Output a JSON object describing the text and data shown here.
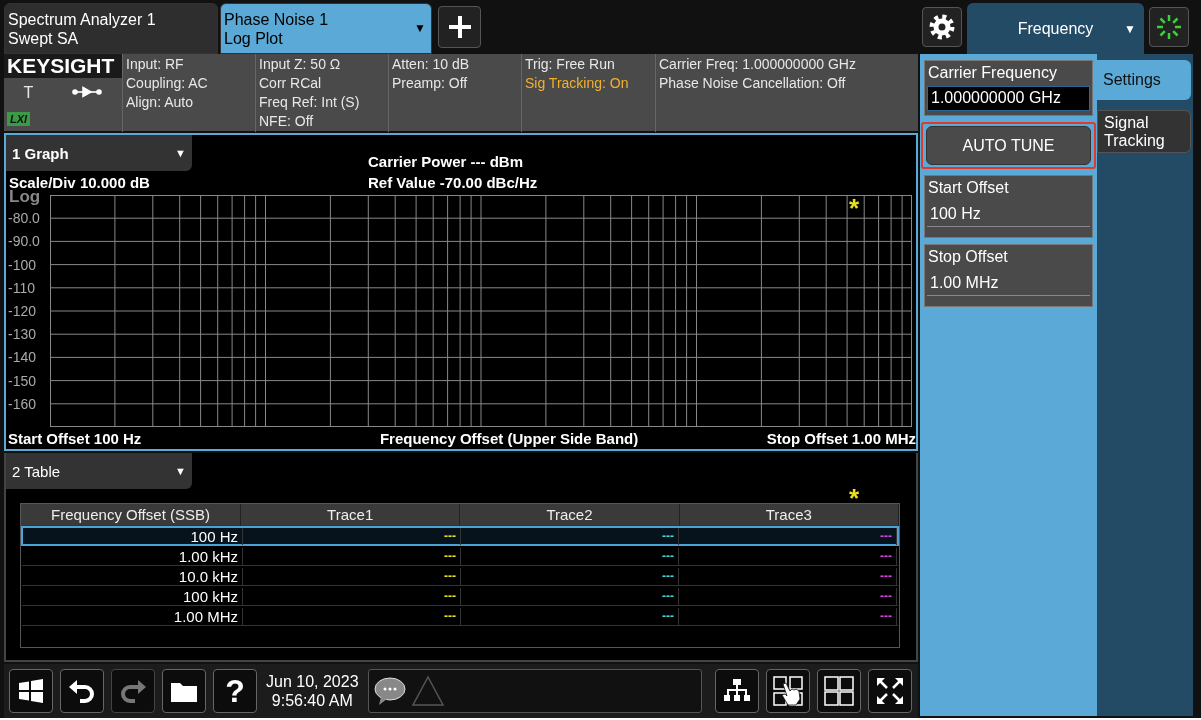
{
  "instrument_tabs": [
    {
      "line1": "Spectrum Analyzer 1",
      "line2": "Swept SA",
      "selected": false
    },
    {
      "line1": "Phase Noise 1",
      "line2": "Log Plot",
      "selected": true,
      "arrow": "▼"
    }
  ],
  "menu": {
    "label": "Frequency",
    "arrow": "▼"
  },
  "logo": {
    "brand": "KEYSIGHT",
    "trigger": "T",
    "lxi": "LXI"
  },
  "info_cells": [
    {
      "lines": [
        {
          "text": "Input: RF",
          "highlight": false
        },
        {
          "text": "Coupling: AC",
          "highlight": false
        },
        {
          "text": "Align: Auto",
          "highlight": false
        }
      ]
    },
    {
      "lines": [
        {
          "text": "Input Z: 50 Ω",
          "highlight": false
        },
        {
          "text": "Corr RCal",
          "highlight": false
        },
        {
          "text": "Freq Ref: Int (S)",
          "highlight": false
        },
        {
          "text": "NFE: Off",
          "highlight": false
        }
      ]
    },
    {
      "lines": [
        {
          "text": "Atten: 10 dB",
          "highlight": false
        },
        {
          "text": "Preamp: Off",
          "highlight": false
        }
      ]
    },
    {
      "lines": [
        {
          "text": "Trig: Free Run",
          "highlight": false
        },
        {
          "text": "Sig Tracking: On",
          "highlight": true
        }
      ]
    },
    {
      "lines": [
        {
          "text": "Carrier Freq: 1.000000000 GHz",
          "highlight": false
        },
        {
          "text": "Phase Noise Cancellation: Off",
          "highlight": false
        }
      ]
    }
  ],
  "graph": {
    "window_label": "1 Graph",
    "arrow": "▼",
    "carrier_power": "Carrier Power --- dBm",
    "scale": "Scale/Div 10.000 dB",
    "ref_value": "Ref Value -70.00 dBc/Hz",
    "scale_type": "Log",
    "y_labels": [
      "-80.0",
      "-90.0",
      "-100",
      "-110",
      "-120",
      "-130",
      "-140",
      "-150",
      "-160"
    ],
    "star": "*",
    "start": "Start Offset 100 Hz",
    "x_title": "Frequency Offset (Upper Side Band)",
    "stop": "Stop Offset 1.00 MHz"
  },
  "table": {
    "window_label": "2 Table",
    "arrow": "▼",
    "star": "*",
    "columns": [
      {
        "label": "Frequency Offset (SSB)"
      },
      {
        "label": "Trace1",
        "color": "#e8e020"
      },
      {
        "label": "Trace2",
        "color": "#40d8e0"
      },
      {
        "label": "Trace3",
        "color": "#e040e8"
      }
    ],
    "rows": [
      {
        "offset": "100 Hz",
        "values": [
          "---",
          "---",
          "---"
        ],
        "selected": true
      },
      {
        "offset": "1.00 kHz",
        "values": [
          "---",
          "---",
          "---"
        ],
        "selected": false
      },
      {
        "offset": "10.0 kHz",
        "values": [
          "---",
          "---",
          "---"
        ],
        "selected": false
      },
      {
        "offset": "100 kHz",
        "values": [
          "---",
          "---",
          "---"
        ],
        "selected": false
      },
      {
        "offset": "1.00 MHz",
        "values": [
          "---",
          "---",
          "---"
        ],
        "selected": false
      }
    ]
  },
  "taskbar": {
    "left_buttons": [
      {
        "kind": "windows",
        "disabled": false
      },
      {
        "kind": "undo",
        "disabled": false
      },
      {
        "kind": "redo",
        "disabled": true
      },
      {
        "kind": "folder",
        "disabled": false
      },
      {
        "kind": "help",
        "glyph": "?",
        "disabled": false
      }
    ],
    "date": "Jun 10, 2023",
    "time": "9:56:40 AM",
    "right_buttons": [
      {
        "kind": "network"
      },
      {
        "kind": "touch"
      },
      {
        "kind": "layout"
      },
      {
        "kind": "fullscreen"
      }
    ]
  },
  "side_tabs": [
    {
      "label": "Settings",
      "selected": true
    },
    {
      "label": "Signal Tracking",
      "selected": false
    }
  ],
  "controls": [
    {
      "kind": "field",
      "label": "Carrier Frequency",
      "value": "1.000000000 GHz",
      "focused": true
    },
    {
      "kind": "button",
      "label": "AUTO TUNE",
      "highlighted": true
    },
    {
      "kind": "field",
      "label": "Start Offset",
      "value": "100 Hz",
      "focused": false
    },
    {
      "kind": "field",
      "label": "Stop Offset",
      "value": "1.00 MHz",
      "focused": false
    }
  ]
}
